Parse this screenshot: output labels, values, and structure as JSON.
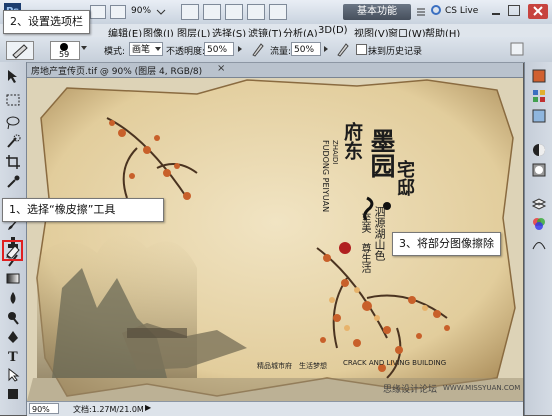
{
  "callouts": {
    "step1": "1、选择“橡皮擦”工具",
    "step2": "2、设置选项栏",
    "step3": "3、将部分图像擦除"
  },
  "appbar": {
    "zoom": "90%",
    "workspace": "基本功能",
    "cs_live": "CS Live"
  },
  "menu": [
    "编辑(E)",
    "图像(I)",
    "图层(L)",
    "选择(S)",
    "滤镜(T)",
    "分析(A)",
    "3D(D)",
    "视图(V)",
    "窗口(W)",
    "帮助(H)"
  ],
  "options": {
    "brush_size": "59",
    "mode_label": "模式:",
    "mode_value": "画笔",
    "opacity_label": "不透明度:",
    "opacity_value": "50%",
    "flow_label": "流量:",
    "flow_value": "50%",
    "history_label": "抹到历史记录"
  },
  "document": {
    "tab_title": "房地产宣传页.tif @ 90% (图层 4, RGB/8)",
    "zoom": "90%",
    "doc_size": "文档:1.27M/21.0M"
  },
  "artwork": {
    "title_big": "府东",
    "title_mid": "墨园",
    "title_last": "宅邸",
    "pinyin": "FUDONG PEIYUAN",
    "pinyin2": "ZHAIDI",
    "slogan1": "泗",
    "slogan_line1": "泗源湖山色",
    "slogan_line2": "至美",
    "slogan_line3": "尊生活",
    "bottom_en": "CRACK AND LIVING BUILDING",
    "bottom_cn1": "精品城市府",
    "bottom_cn2": "生活梦想",
    "watermark": "思缘设计论坛",
    "watermark_url": "WWW.MISSYUAN.COM"
  },
  "colors": {
    "paper": "#e3cfa0",
    "ink": "#1c1c1c",
    "blossom": "#c8602a",
    "highlight": "#e02020"
  }
}
